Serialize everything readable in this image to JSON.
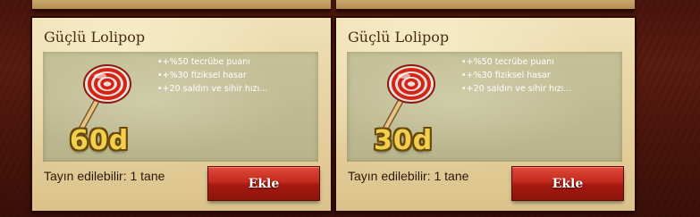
{
  "colors": {
    "card_bg": "#e6d1a0",
    "panel_bg": "#c5c199",
    "duration_gold": "#f3cf4e",
    "button_red": "#c22a1d",
    "page_bg": "#4a150c"
  },
  "cards": [
    {
      "title": "Güçlü Lolipop",
      "icon": "lollipop-icon",
      "bonuses": [
        "+%50 tecrübe puanı",
        "+%30 fiziksel hasar",
        "+20 saldırı ve sihir hızı..."
      ],
      "duration": "60d",
      "assignable": "Tayın edilebilir: 1 tane",
      "button_label": "Ekle"
    },
    {
      "title": "Güçlü Lolipop",
      "icon": "lollipop-icon",
      "bonuses": [
        "+%50 tecrübe puanı",
        "+%30 fiziksel hasar",
        "+20 saldırı ve sihir hızı..."
      ],
      "duration": "30d",
      "assignable": "Tayın edilebilir: 1 tane",
      "button_label": "Ekle"
    }
  ]
}
